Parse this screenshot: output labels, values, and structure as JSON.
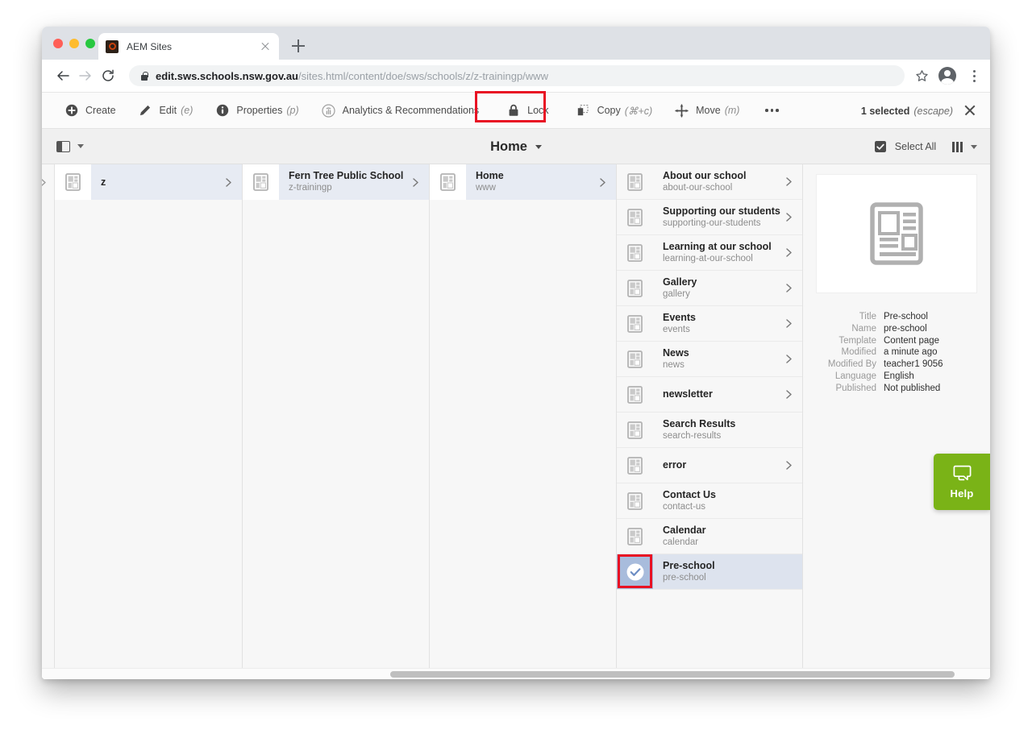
{
  "browser": {
    "tab_title": "AEM Sites",
    "favicon_name": "aem-logo-icon",
    "url_bold": "edit.sws.schools.nsw.gov.au",
    "url_rest": "/sites.html/content/doe/sws/schools/z/z-trainingp/www",
    "new_tab_label": "+",
    "close_tab_label": "x"
  },
  "actionbar": {
    "items": [
      {
        "label": "Create",
        "shortcut": "",
        "icon": "plus-circle-icon"
      },
      {
        "label": "Edit",
        "shortcut": "(e)",
        "icon": "pencil-icon"
      },
      {
        "label": "Properties",
        "shortcut": "(p)",
        "icon": "info-circle-icon"
      },
      {
        "label": "Analytics & Recommendations",
        "shortcut": "",
        "icon": "analytics-icon"
      },
      {
        "label": "Lock",
        "shortcut": "",
        "icon": "lock-icon"
      },
      {
        "label": "Copy",
        "shortcut": "(⌘+c)",
        "icon": "copy-icon"
      },
      {
        "label": "Move",
        "shortcut": "(m)",
        "icon": "move-icon"
      }
    ],
    "more_label": "•••",
    "selection_count": "1 selected",
    "selection_escape": "(escape)"
  },
  "viewbar": {
    "panel_toggle_icon": "side-panel-icon",
    "breadcrumb": "Home",
    "select_all": "Select All",
    "layout_icon": "column-view-icon"
  },
  "columns": [
    {
      "name": "column-z",
      "rows": [
        {
          "title": "z",
          "name": "",
          "chevron": true,
          "selected": false
        }
      ]
    },
    {
      "name": "column-school",
      "rows": [
        {
          "title": "Fern Tree Public School",
          "name": "z-trainingp",
          "chevron": true,
          "selected": false
        }
      ]
    },
    {
      "name": "column-home",
      "rows": [
        {
          "title": "Home",
          "name": "www",
          "chevron": true,
          "selected": false
        }
      ]
    },
    {
      "name": "column-pages",
      "rows": [
        {
          "title": "About our school",
          "name": "about-our-school",
          "chevron": true,
          "selected": false
        },
        {
          "title": "Supporting our students",
          "name": "supporting-our-students",
          "chevron": true,
          "selected": false
        },
        {
          "title": "Learning at our school",
          "name": "learning-at-our-school",
          "chevron": true,
          "selected": false
        },
        {
          "title": "Gallery",
          "name": "gallery",
          "chevron": true,
          "selected": false
        },
        {
          "title": "Events",
          "name": "events",
          "chevron": true,
          "selected": false
        },
        {
          "title": "News",
          "name": "news",
          "chevron": true,
          "selected": false
        },
        {
          "title": "newsletter",
          "name": "",
          "chevron": true,
          "selected": false
        },
        {
          "title": "Search Results",
          "name": "search-results",
          "chevron": false,
          "selected": false
        },
        {
          "title": "error",
          "name": "",
          "chevron": true,
          "selected": false
        },
        {
          "title": "Contact Us",
          "name": "contact-us",
          "chevron": false,
          "selected": false
        },
        {
          "title": "Calendar",
          "name": "calendar",
          "chevron": false,
          "selected": false
        },
        {
          "title": "Pre-school",
          "name": "pre-school",
          "chevron": false,
          "selected": true
        }
      ]
    }
  ],
  "detail": {
    "thumbnail_icon": "content-page-thumbnail-icon",
    "fields": [
      {
        "key": "Title",
        "value": "Pre-school"
      },
      {
        "key": "Name",
        "value": "pre-school"
      },
      {
        "key": "Template",
        "value": "Content page"
      },
      {
        "key": "Modified",
        "value": "a minute ago"
      },
      {
        "key": "Modified By",
        "value": "teacher1 9056"
      },
      {
        "key": "Language",
        "value": "English"
      },
      {
        "key": "Published",
        "value": "Not published"
      }
    ]
  },
  "help_widget": {
    "label": "Help",
    "icon": "chat-bubbles-icon",
    "color": "#7ab317"
  },
  "annotations": {
    "accent_color": "#e81123",
    "targets": [
      "lock-button",
      "pre-school-checkbox"
    ]
  }
}
